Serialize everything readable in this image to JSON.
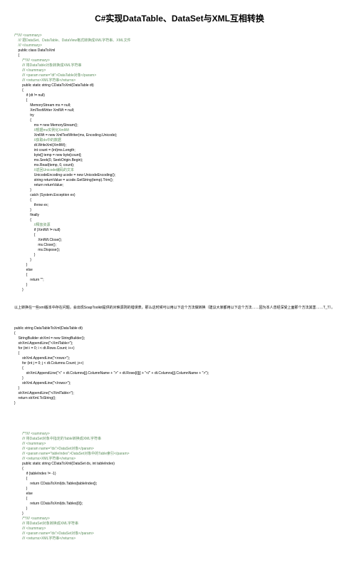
{
  "title": "C#实现DataTable、DataSet与XML互相转换",
  "topComment": [
    "/**//// <summary>",
    "    /// 把DataSet、DataTable、DataView格式转换成XML字符串、XML文件",
    "    /// </summary>",
    "    public class DataToXml",
    "    {"
  ],
  "method1Comment": [
    "        /**//// <summary>",
    "        /// 将DataTable对象转换成XML字符串",
    "        /// </summary>",
    "        /// <param name=\"dt\">DataTable对象</param>",
    "        /// <returns>XML字符串</returns>",
    "        public static string CDataToXml(DataTable dt)",
    "        {"
  ],
  "method1Body": [
    "            if (dt != null)",
    "            {",
    "                MemoryStream ms = null;",
    "                XmlTextWriter XmlWt = null;",
    "                try",
    "                {",
    "                    ms = new MemoryStream();",
    "                    //根据ms实例化XmlWt",
    "                    XmlWt = new XmlTextWriter(ms, Encoding.Unicode);",
    "                    //获取ds中的数据",
    "                    dt.WriteXml(XmlWt);",
    "                    int count = (int)ms.Length;",
    "                    byte[] temp = new byte[count];",
    "                    ms.Seek(0, SeekOrigin.Begin);",
    "                    ms.Read(temp, 0, count);",
    "                    //返回Unicode编码的文本",
    "                    UnicodeEncoding ucode = new UnicodeEncoding();",
    "                    string returnValue = ucode.GetString(temp).Trim();",
    "                    return returnValue;",
    "                }",
    "                catch (System.Exception ex)",
    "                {",
    "                    throw ex;",
    "                }",
    "                finally",
    "                {",
    "                    //释放资源",
    "                    if (XmlWt != null)",
    "                    {",
    "                        XmlWt.Close();",
    "                        ms.Close();",
    "                        ms.Dispose();",
    "                    }",
    "                }",
    "            }",
    "            else",
    "            {",
    "                return \"\";",
    "            }",
    "        }"
  ],
  "paragraph": "以上转换在一些xml版本中存在问题，会出现SoapToolkit提供的对映源则的错误表，那么这时候可以用以下这个方法做转换（建议大家都用以下这个方法……因为本人曾经深受上面那个方法其害……T_T）。",
  "method2Sig": "public string DataTableToXml(DataTable dt)",
  "method2Body": [
    "{",
    "    StringBuilder strXml = new StringBuilder();",
    "    strXml.AppendLine(\"<XmlTable>\");",
    "    for (int i = 0; i < dt.Rows.Count; i++)",
    "    {",
    "        strXml.AppendLine(\"<rows>\");",
    "        for (int j = 0; j < dt.Columns.Count; j++)",
    "        {",
    "            strXml.AppendLine(\"<\" + dt.Columns[j].ColumnName + \">\" + dt.Rows[i][j] + \"</\" + dt.Columns[j].ColumnName + \">\");",
    "        }",
    "        strXml.AppendLine(\"</rows>\");",
    "    }",
    "    strXml.AppendLine(\"</XmlTable>\");",
    "    return strXml.ToString();",
    "}"
  ],
  "method3Comment": [
    "        /**//// <summary>",
    "        /// 将DataSet对象中指定的Table转换成XML字符串",
    "        /// </summary>",
    "        /// <param name=\"ds\">DataSet对象</param>",
    "        /// <param name=\"tableIndex\">DataSet对象中的Table索引</param>",
    "        /// <returns>XML字符串</returns>",
    "        public static string CDataToXml(DataSet ds, int tableIndex)",
    "        {"
  ],
  "method3Body": [
    "            if (tableIndex != -1)",
    "            {",
    "                return CDataToXml(ds.Tables[tableIndex]);",
    "            }",
    "            else",
    "            {",
    "                return CDataToXml(ds.Tables[0]);",
    "            }",
    "        }"
  ],
  "method4Comment": [
    "        /**//// <summary>",
    "        /// 将DataSet对象转换成XML字符串",
    "        /// </summary>",
    "        /// <param name=\"ds\">DataSet对象</param>",
    "        /// <returns>XML字符串</returns>"
  ]
}
